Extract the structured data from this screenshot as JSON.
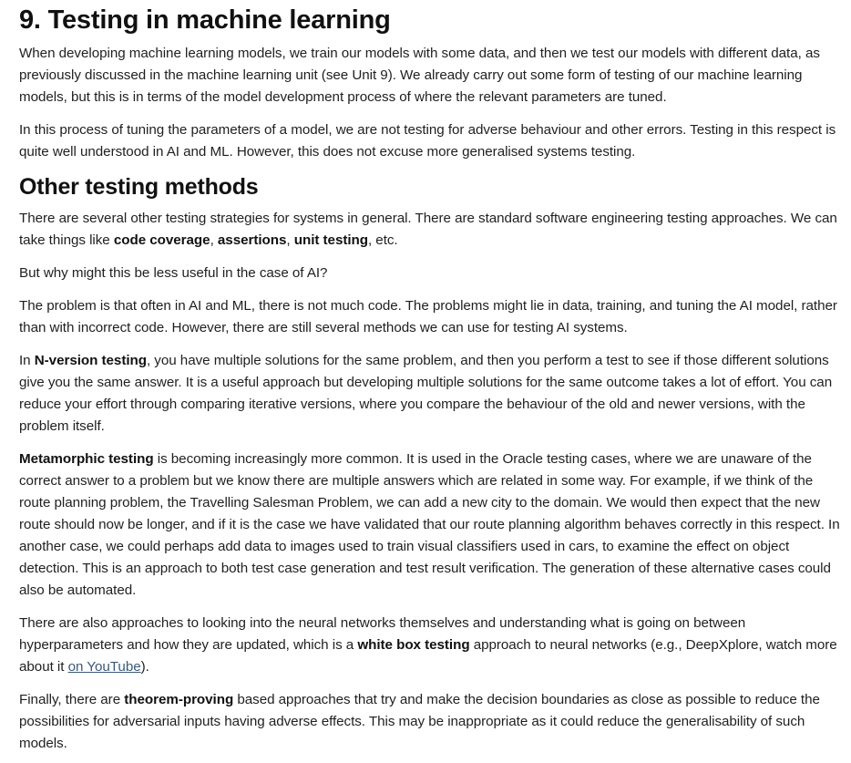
{
  "title": "9. Testing in machine learning",
  "intro": [
    "When developing machine learning models, we train our models with some data, and then we test our models with different data, as previously discussed in the machine learning unit (see Unit 9). We already carry out some form of testing of our machine learning models, but this is in terms of the model development process of where the relevant parameters are tuned.",
    "In this process of tuning the parameters of a model, we are not testing for adverse behaviour and other errors. Testing in this respect is quite well understood in AI and ML. However, this does not excuse more generalised systems testing."
  ],
  "section_heading": "Other testing methods",
  "p1": {
    "pre": "There are several other testing strategies for systems in general. There are standard software engineering testing approaches. We can take things like ",
    "b1": "code coverage",
    "sep1": ", ",
    "b2": "assertions",
    "sep2": ", ",
    "b3": "unit testing",
    "post": ", etc."
  },
  "p2": "But why might this be less useful in the case of AI?",
  "p3": "The problem is that often in AI and ML, there is not much code. The problems might lie in data, training, and tuning the AI model, rather than with incorrect code. However, there are still several methods we can use for testing AI systems.",
  "p4": {
    "pre": "In ",
    "bold": "N-version testing",
    "post": ", you have multiple solutions for the same problem, and then you perform a test to see if those different solutions give you the same answer. It is a useful approach but developing multiple solutions for the same outcome takes a lot of effort. You can reduce your effort through comparing iterative versions, where you compare the behaviour of the old and newer versions, with the problem itself."
  },
  "p5": {
    "bold": "Metamorphic testing",
    "post": " is becoming increasingly more common. It is used in the Oracle testing cases, where we are unaware of  the correct answer to a problem but we know there are multiple answers which are related in some way. For example, if we think of the route planning problem, the Travelling Salesman Problem, we can add a new city to the domain. We would then expect that the new route should now be longer, and if it is the case we have validated that our route planning algorithm behaves correctly in this respect. In another case, we could perhaps add data to images used to train visual classifiers used in cars, to examine the effect on object detection. This is an approach to both test case generation and test result verification. The generation of these alternative cases could also be automated."
  },
  "p6": {
    "pre": "There are also approaches to looking into the neural networks themselves and understanding what is going on between hyperparameters and how they are updated, which is a ",
    "bold": "white box testing",
    "mid": " approach to neural networks (e.g., DeepXplore, watch more about it ",
    "link": "on YouTube",
    "post": ")."
  },
  "p7": {
    "pre": "Finally, there are ",
    "bold": "theorem-proving",
    "post": " based approaches that try and make the decision boundaries as close as possible to reduce the possibilities for adversarial inputs having adverse effects. This may be inappropriate as it could reduce  the generalisability of such models."
  }
}
